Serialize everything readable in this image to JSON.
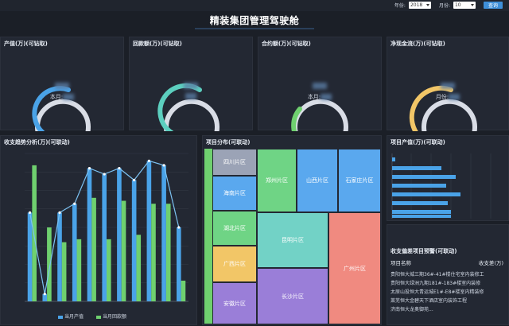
{
  "header": {
    "title": "精装集团管理驾驶舱",
    "year_label": "年份:",
    "year_value": "2018",
    "month_label": "月份:",
    "month_value": "10",
    "query_label": "查询"
  },
  "kpis": [
    {
      "title": "产值(万)(可钻取)",
      "sub_label": "本月:",
      "color": "#4aa3e8"
    },
    {
      "title": "回款额(万)(可钻取)",
      "sub_label": "",
      "color": "#5ccfbf"
    },
    {
      "title": "合约额(万)(可钻取)",
      "sub_label": "本月:",
      "color": "#6fd06f"
    },
    {
      "title": "净现金流(万)(可钻取)",
      "sub_label": "月份:",
      "color": "#f2c667"
    }
  ],
  "trend": {
    "title": "收支趋势分析(万)(可联动)",
    "legend": [
      "当月产值",
      "当月回款额"
    ],
    "colors": {
      "bar_blue": "#4aa3e8",
      "bar_green": "#6fd06f",
      "line": "#7cc2f2"
    }
  },
  "treemap": {
    "title": "项目分布(可联动)",
    "cells": [
      {
        "label": "四川片区",
        "color": "#9ba3b6"
      },
      {
        "label": "海南片区",
        "color": "#5aa8ee"
      },
      {
        "label": "湖北片区",
        "color": "#6fd485"
      },
      {
        "label": "广西片区",
        "color": "#f2c667"
      },
      {
        "label": "安徽片区",
        "color": "#9a7ed8"
      },
      {
        "label": "郑州片区",
        "color": "#6fd485"
      },
      {
        "label": "山西片区",
        "color": "#5aa8ee"
      },
      {
        "label": "石家庄片区",
        "color": "#5aa8ee"
      },
      {
        "label": "昆明片区",
        "color": "#72d2c6"
      },
      {
        "label": "长沙片区",
        "color": "#9a7ed8"
      },
      {
        "label": "广州片区",
        "color": "#f08a80"
      }
    ]
  },
  "output_rank": {
    "title": "项目产值(万)(可联动)",
    "bar_color": "#4aa3e8"
  },
  "warning": {
    "title": "收支偏差项目预警(可联动)",
    "col_name": "项目名称",
    "col_value": "收支差(万)",
    "rows": [
      "贵阳恒大城三期36#-41#楼住宅室内装修工",
      "贵阳恒大绿洲九期181#-183#楼室内装修",
      "太原山投恒大青运城E1#-E8#楼室内精装修",
      "莱芜恒大金碧天下酒店室内装饰工程",
      "济南恒大龙奥御苑..."
    ]
  }
}
